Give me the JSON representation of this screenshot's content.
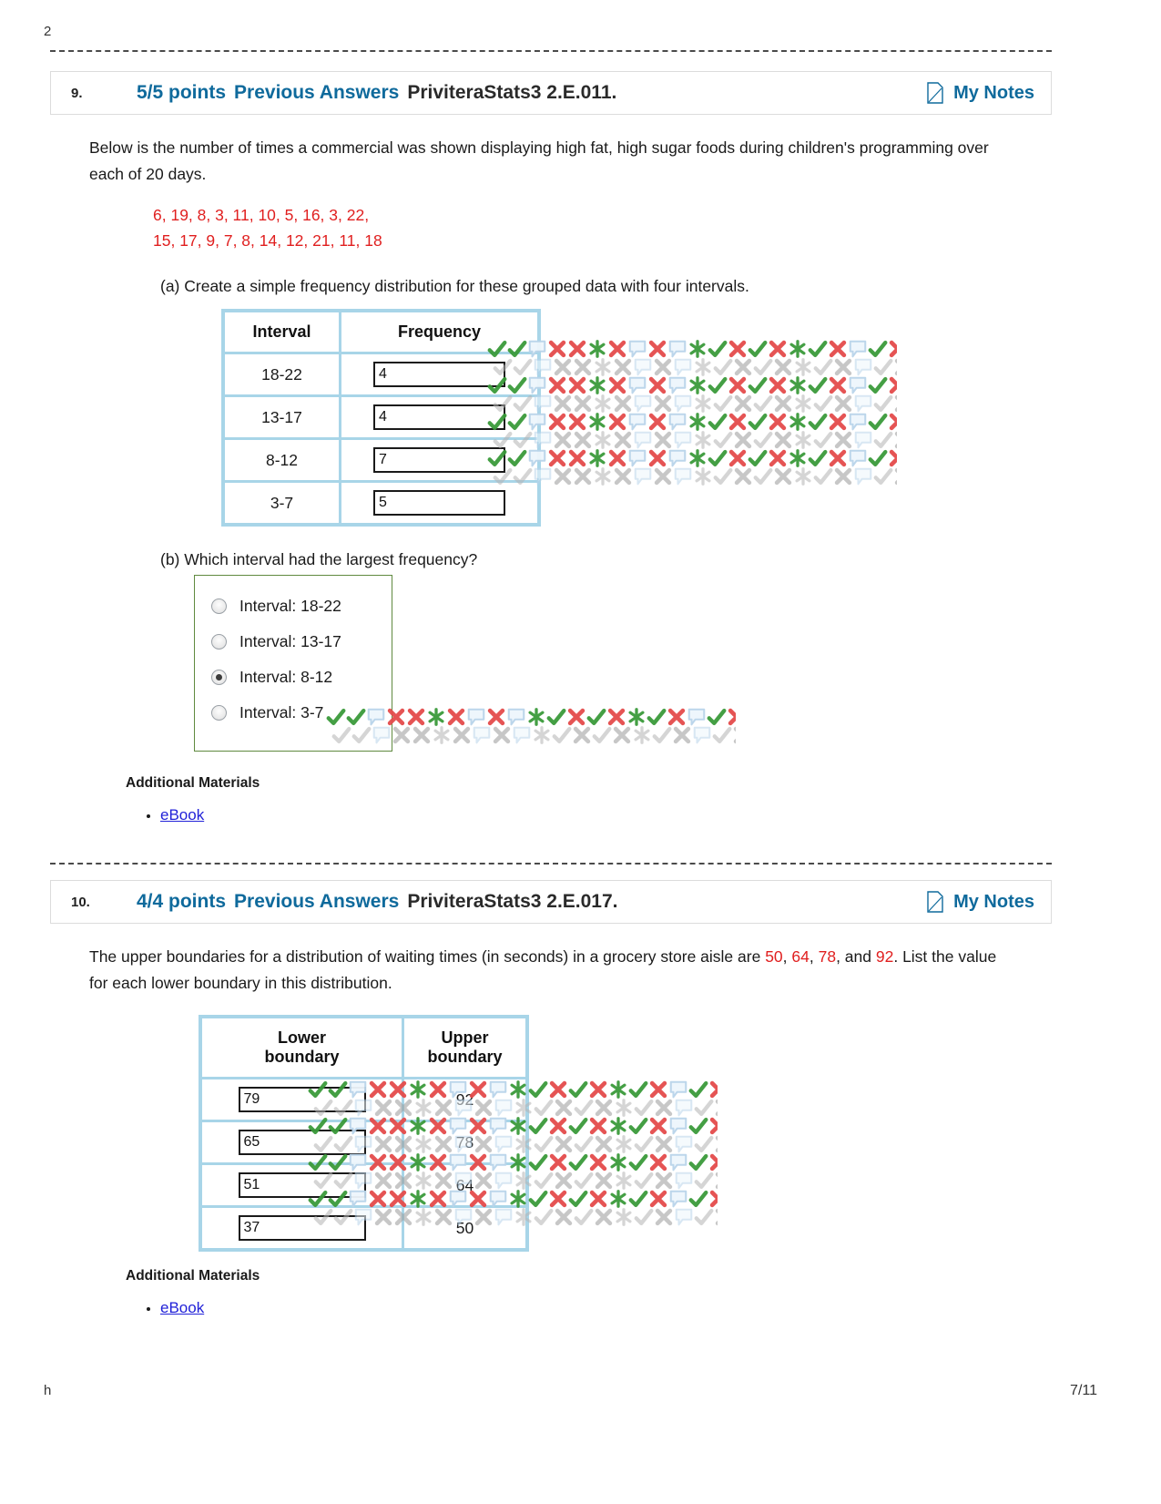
{
  "page": {
    "top_clipped_text": "2",
    "bottom_clipped_text": "h",
    "page_number": "7/11"
  },
  "questions": [
    {
      "number": "9.",
      "points": "5/5 points",
      "previous_answers": "Previous Answers",
      "code": "PriviteraStats3 2.E.011.",
      "my_notes": "My Notes",
      "note_icon": "note-page-icon",
      "prompt": "Below is the number of times a commercial was shown displaying high fat, high sugar foods during children's programming over each of 20 days.",
      "data_line_1": "6, 19, 8, 3, 11, 10, 5, 16, 3, 22,",
      "data_line_2": "15, 17, 9, 7, 8, 14, 12, 21, 11, 18",
      "part_a": "(a) Create a simple frequency distribution for these grouped data with four intervals.",
      "table": {
        "headers": [
          "Interval",
          "Frequency"
        ],
        "rows": [
          {
            "interval": "18-22",
            "frequency": "4"
          },
          {
            "interval": "13-17",
            "frequency": "4"
          },
          {
            "interval": "8-12",
            "frequency": "7"
          },
          {
            "interval": "3-7",
            "frequency": "5"
          }
        ]
      },
      "part_b": "(b) Which interval had the largest frequency?",
      "choices": [
        {
          "label": "Interval: 18-22",
          "selected": false
        },
        {
          "label": "Interval: 13-17",
          "selected": false
        },
        {
          "label": "Interval: 8-12",
          "selected": true
        },
        {
          "label": "Interval: 3-7",
          "selected": false
        }
      ],
      "additional_materials": "Additional Materials",
      "materials": [
        "eBook"
      ]
    },
    {
      "number": "10.",
      "points": "4/4 points",
      "previous_answers": "Previous Answers",
      "code": "PriviteraStats3 2.E.017.",
      "my_notes": "My Notes",
      "note_icon": "note-page-icon",
      "prompt_part1": "The upper boundaries for a distribution of waiting times (in seconds) in a grocery store aisle are ",
      "prompt_values": [
        "50",
        "64",
        "78",
        "92"
      ],
      "prompt_part2": "List the value for each lower boundary in this distribution.",
      "table": {
        "headers": [
          "Lower boundary",
          "Upper boundary"
        ],
        "rows": [
          {
            "lower": "79",
            "upper": "92"
          },
          {
            "lower": "65",
            "upper": "78"
          },
          {
            "lower": "51",
            "upper": "64"
          },
          {
            "lower": "37",
            "upper": "50"
          }
        ]
      },
      "additional_materials": "Additional Materials",
      "materials": [
        "eBook"
      ]
    }
  ],
  "colors": {
    "accent_blue": "#0f6a9c",
    "red_value": "#e01f1f",
    "link_blue": "#2121d8",
    "table_border": "#a8d5e8",
    "correct_green": "#3a9a3a",
    "incorrect_red": "#e44b4b"
  }
}
